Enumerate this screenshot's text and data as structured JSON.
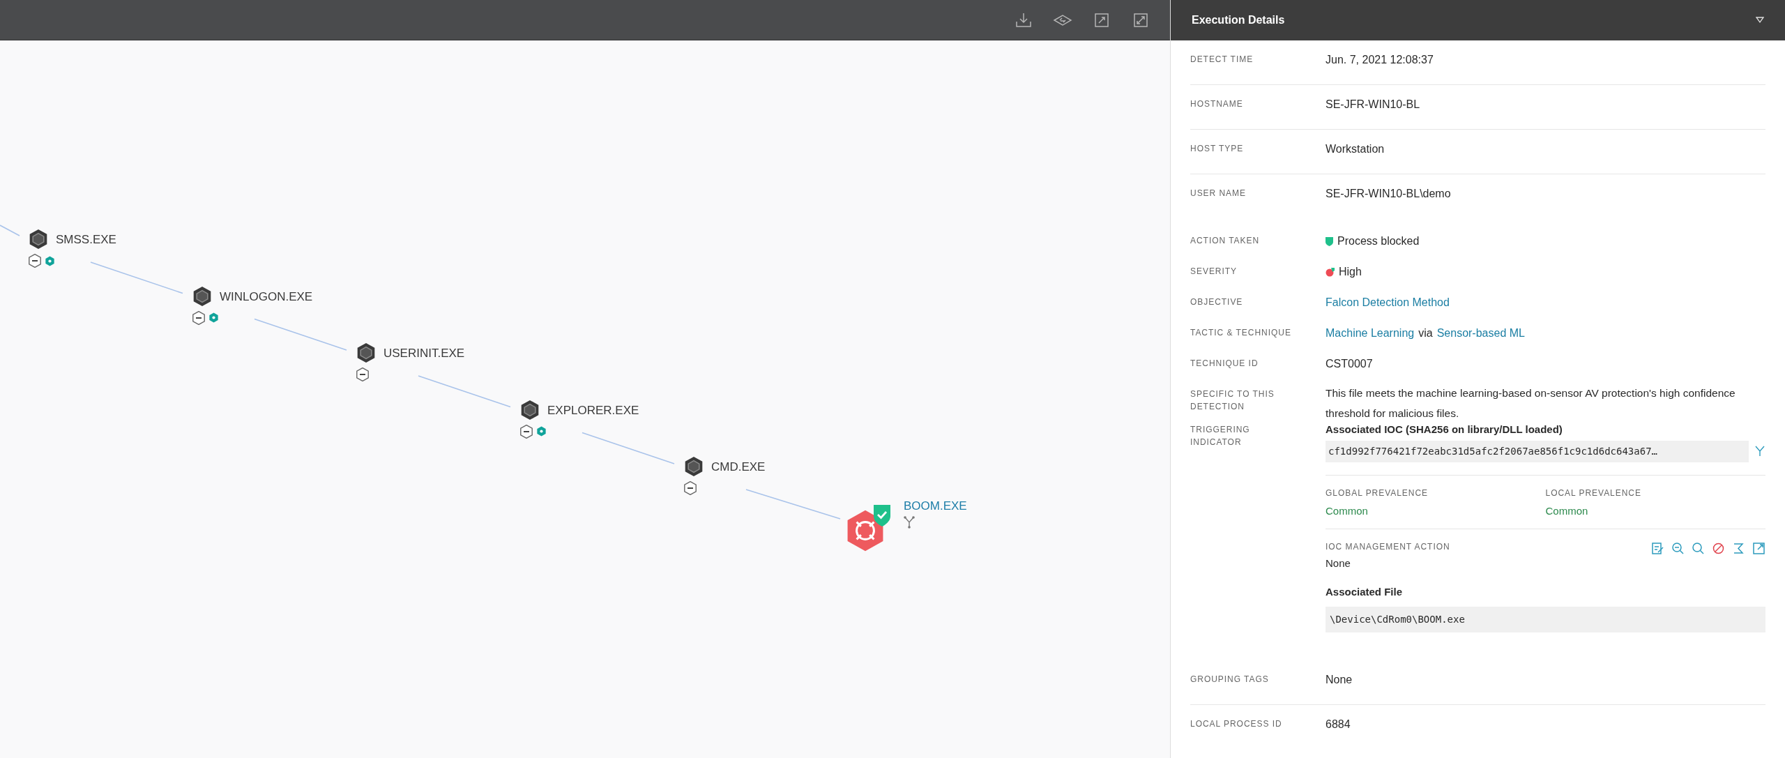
{
  "graph": {
    "nodes": [
      {
        "name": "SMSS.EXE",
        "kind": "process",
        "extra_badge": true
      },
      {
        "name": "WINLOGON.EXE",
        "kind": "process",
        "extra_badge": true
      },
      {
        "name": "USERINIT.EXE",
        "kind": "process",
        "extra_badge": false
      },
      {
        "name": "EXPLORER.EXE",
        "kind": "process",
        "extra_badge": true
      },
      {
        "name": "CMD.EXE",
        "kind": "process",
        "extra_badge": false
      },
      {
        "name": "BOOM.EXE",
        "kind": "detection",
        "blocked": true
      }
    ]
  },
  "panel": {
    "title": "Execution Details",
    "summary_fields": [
      {
        "label": "DETECT TIME",
        "kind": "text",
        "value": "Jun. 7, 2021 12:08:37"
      },
      {
        "label": "HOSTNAME",
        "kind": "text",
        "value": "SE-JFR-WIN10-BL"
      },
      {
        "label": "HOST TYPE",
        "kind": "text",
        "value": "Workstation"
      },
      {
        "label": "USER NAME",
        "kind": "text",
        "value": "SE-JFR-WIN10-BL\\demo"
      }
    ],
    "detection_fields": [
      {
        "label": "ACTION TAKEN",
        "kind": "action",
        "value": "Process blocked"
      },
      {
        "label": "SEVERITY",
        "kind": "severity",
        "value": "High"
      },
      {
        "label": "OBJECTIVE",
        "kind": "link",
        "value": "Falcon Detection Method"
      },
      {
        "label": "TACTIC & TECHNIQUE",
        "kind": "parts",
        "parts": [
          {
            "text": "Machine Learning",
            "link": true
          },
          {
            "text": "via",
            "link": false
          },
          {
            "text": "Sensor-based ML",
            "link": true
          }
        ]
      },
      {
        "label": "TECHNIQUE ID",
        "kind": "text",
        "value": "CST0007"
      },
      {
        "label": "SPECIFIC TO THIS DETECTION",
        "kind": "paragraph",
        "value": "This file meets the machine learning-based on-sensor AV protection's high confidence threshold for malicious files."
      },
      {
        "label": "TRIGGERING INDICATOR",
        "kind": "indicator",
        "heading": "Associated IOC (SHA256 on library/DLL loaded)",
        "hash": "cf1d992f776421f72eabc31d5afc2f2067ae856f1c9c1d6dc643a67…",
        "prevalence": [
          {
            "label": "GLOBAL PREVALENCE",
            "value": "Common"
          },
          {
            "label": "LOCAL PREVALENCE",
            "value": "Common"
          }
        ],
        "ioc_action_label": "IOC MANAGEMENT ACTION",
        "ioc_action": "None",
        "file_heading": "Associated File",
        "file_path": "\\Device\\CdRom0\\BOOM.exe"
      }
    ],
    "extra_fields": [
      {
        "label": "GROUPING TAGS",
        "kind": "text",
        "value": "None"
      },
      {
        "label": "LOCAL PROCESS ID",
        "kind": "text",
        "value": "6884"
      }
    ]
  }
}
